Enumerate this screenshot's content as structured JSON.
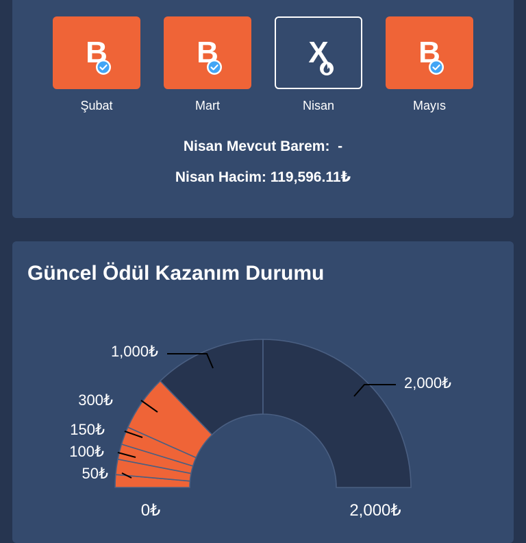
{
  "months": [
    {
      "name": "Şubat",
      "letter": "B",
      "status": "won"
    },
    {
      "name": "Mart",
      "letter": "B",
      "status": "won"
    },
    {
      "name": "Nisan",
      "letter": "X",
      "status": "lost"
    },
    {
      "name": "Mayıs",
      "letter": "B",
      "status": "won"
    }
  ],
  "summary": {
    "current_barem_label": "Nisan Mevcut Barem:",
    "current_barem_value": "-",
    "volume_label": "Nisan Hacim:",
    "volume_value": "119,596.11₺"
  },
  "reward_section": {
    "title": "Güncel Ödül Kazanım Durumu"
  },
  "colors": {
    "accent": "#ef6437",
    "dark_segment": "#26344f",
    "card": "#344a6d",
    "background": "#263550"
  },
  "chart_data": {
    "type": "gauge",
    "tiers": [
      {
        "label": "50₺",
        "value": 50,
        "achieved": true
      },
      {
        "label": "100₺",
        "value": 100,
        "achieved": true
      },
      {
        "label": "150₺",
        "value": 150,
        "achieved": true
      },
      {
        "label": "300₺",
        "value": 300,
        "achieved": true
      },
      {
        "label": "1,000₺",
        "value": 1000,
        "achieved": false
      },
      {
        "label": "2,000₺",
        "value": 2000,
        "achieved": false
      }
    ],
    "min_label": "0₺",
    "max_label": "2,000₺",
    "range": [
      0,
      2000
    ]
  }
}
